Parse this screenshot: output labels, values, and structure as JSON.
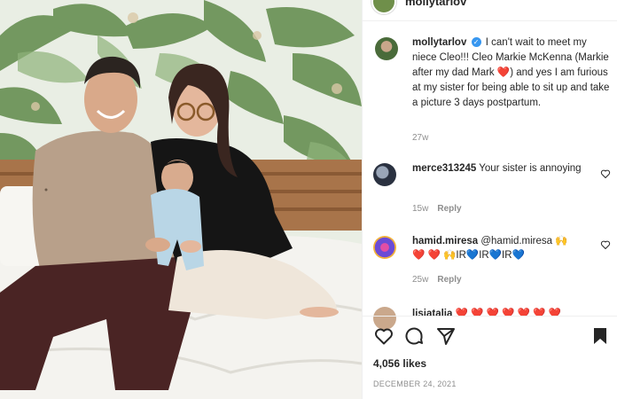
{
  "post": {
    "header_username": "mollytarlov",
    "caption_username": "mollytarlov",
    "caption_text": "I can't wait to meet my niece Cleo!!! Cleo Markie McKenna (Markie after my dad Mark ",
    "caption_heart": "❤️",
    "caption_text_2": ") and yes I am furious at my sister for being able to sit up and take a picture 3 days postpartum.",
    "caption_time": "27w"
  },
  "comments": [
    {
      "username": "merce313245",
      "text": "Your sister is annoying",
      "time": "15w",
      "reply_label": "Reply"
    },
    {
      "username": "hamid.miresa",
      "text": "@hamid.miresa 🙌",
      "emoji_line": [
        "❤️",
        "❤️",
        "🙌",
        "IR",
        "💙",
        "IR",
        "💙",
        "IR",
        "💙"
      ],
      "time": "25w",
      "reply_label": "Reply"
    },
    {
      "username": "lisiatalia",
      "text": "❤️ ❤️ ❤️ ❤️ ❤️ ❤️ ❤️"
    }
  ],
  "stats": {
    "likes": "4,056 likes",
    "date": "DECEMBER 24, 2021"
  },
  "icons": {
    "like": "heart-icon",
    "comment": "comment-icon",
    "share": "send-icon",
    "save": "bookmark-icon",
    "verified": "verified-badge-icon"
  },
  "colors": {
    "heart_red": "#ed1c40",
    "verified_blue": "#3897f0",
    "muted_text": "#8e8e8e"
  }
}
